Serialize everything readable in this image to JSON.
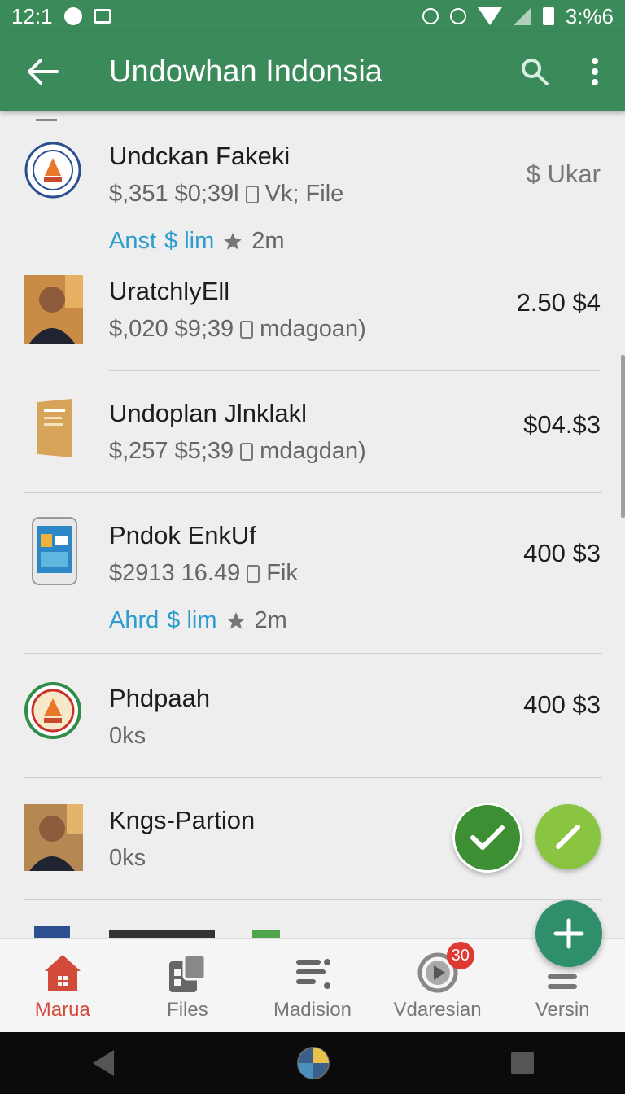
{
  "status_bar": {
    "time": "12:1",
    "battery_text": "3:%6"
  },
  "app_bar": {
    "title": "Undowhan Indonsia",
    "back_icon": "arrow-left-icon",
    "search_icon": "search-icon",
    "menu_icon": "more-vert-icon"
  },
  "items": [
    {
      "name": "Undckan Fakeki",
      "meta_a": "$,351",
      "meta_b": "$0;39l",
      "meta_c": "Vk; File",
      "price": "$ Ukar",
      "link": "Anst",
      "link_b": "$ lim",
      "time": "2m"
    },
    {
      "name": "UratchlyEll",
      "meta_a": "$,020",
      "meta_b": "$9;39",
      "meta_c": "mdagoan)",
      "price": "2.50 $4"
    },
    {
      "name": "Undoplan Jlnklakl",
      "meta_a": "$,257",
      "meta_b": "$5;39",
      "meta_c": "mdagdan)",
      "price": "$04.$3"
    },
    {
      "name": "Pndok EnkUf",
      "meta_a": "$2913",
      "meta_b": "16.49",
      "meta_c": "Fik",
      "price": "400 $3",
      "link": "Ahrd",
      "link_b": "$ lim",
      "time": "2m"
    },
    {
      "name": "Phdpaah",
      "meta_a": "0ks",
      "price": "400 $3"
    },
    {
      "name": "Kngs-Partion",
      "meta_a": "0ks"
    }
  ],
  "bottom_nav": [
    {
      "label": "Marua",
      "icon": "home-icon",
      "active": true
    },
    {
      "label": "Files",
      "icon": "files-icon"
    },
    {
      "label": "Madision",
      "icon": "list-icon"
    },
    {
      "label": "Vdaresian",
      "icon": "play-icon",
      "badge": "30"
    },
    {
      "label": "Versin",
      "icon": "menu-icon"
    }
  ],
  "colors": {
    "primary": "#3a8a5a",
    "link": "#2d9ccf",
    "active_nav": "#d24a3a",
    "check_dark": "#3d8f34",
    "check_light": "#8ac542",
    "fab": "#2f8f6a"
  }
}
